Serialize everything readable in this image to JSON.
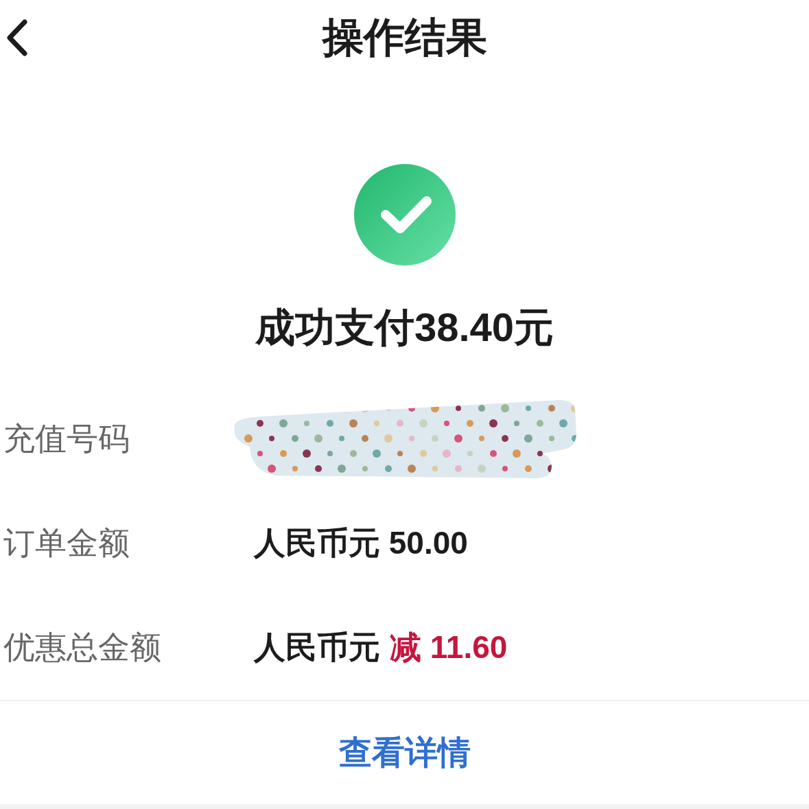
{
  "header": {
    "title": "操作结果"
  },
  "result": {
    "success": true,
    "message": "成功支付38.40元"
  },
  "details": [
    {
      "label": "充值号码",
      "kind": "redacted"
    },
    {
      "label": "订单金额",
      "kind": "text",
      "value_parts": [
        {
          "text": "人民币元 50.00",
          "kind": "normal"
        }
      ]
    },
    {
      "label": "优惠总金额",
      "kind": "text",
      "value_parts": [
        {
          "text": "人民币元",
          "kind": "normal"
        },
        {
          "text": "减 11.60",
          "kind": "discount"
        }
      ]
    }
  ],
  "footer": {
    "action": "查看详情"
  }
}
